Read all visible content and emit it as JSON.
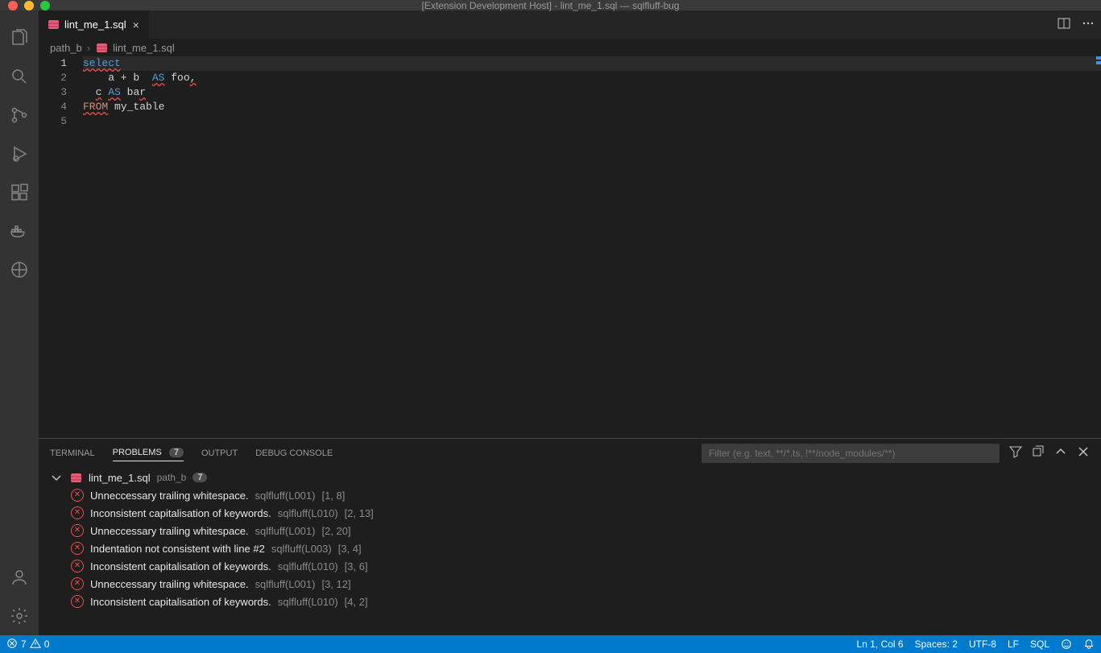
{
  "window": {
    "title": "[Extension Development Host] - lint_me_1.sql — sqlfluff-bug"
  },
  "tab": {
    "filename": "lint_me_1.sql"
  },
  "breadcrumb": {
    "folder": "path_b",
    "file": "lint_me_1.sql"
  },
  "editor": {
    "lines": [
      {
        "num": "1",
        "tokens": [
          {
            "t": "select",
            "cls": "kw-blue squiggle"
          }
        ]
      },
      {
        "num": "2",
        "tokens": [
          {
            "t": "    a + b  ",
            "cls": "plain"
          },
          {
            "t": "AS",
            "cls": "kw-blue squiggle"
          },
          {
            "t": " foo",
            "cls": "plain"
          },
          {
            "t": ",",
            "cls": "plain squiggle"
          }
        ]
      },
      {
        "num": "3",
        "tokens": [
          {
            "t": "  ",
            "cls": "plain"
          },
          {
            "t": "c",
            "cls": "plain squiggle"
          },
          {
            "t": " ",
            "cls": "plain"
          },
          {
            "t": "AS",
            "cls": "kw-blue squiggle"
          },
          {
            "t": " ba",
            "cls": "plain"
          },
          {
            "t": "r",
            "cls": "plain squiggle"
          }
        ]
      },
      {
        "num": "4",
        "tokens": [
          {
            "t": "FROM",
            "cls": "kw-orange squiggle"
          },
          {
            "t": " my_table",
            "cls": "plain"
          }
        ]
      },
      {
        "num": "5",
        "tokens": []
      }
    ]
  },
  "panel": {
    "tabs": {
      "terminal": "TERMINAL",
      "problems": "PROBLEMS",
      "problems_badge": "7",
      "output": "OUTPUT",
      "debug": "DEBUG CONSOLE"
    },
    "filter_placeholder": "Filter (e.g. text, **/*.ts, !**/node_modules/**)",
    "file": {
      "name": "lint_me_1.sql",
      "path": "path_b",
      "count": "7"
    },
    "problems": [
      {
        "msg": "Unneccessary trailing whitespace.",
        "source": "sqlfluff(L001)",
        "loc": "[1, 8]"
      },
      {
        "msg": "Inconsistent capitalisation of keywords.",
        "source": "sqlfluff(L010)",
        "loc": "[2, 13]"
      },
      {
        "msg": "Unneccessary trailing whitespace.",
        "source": "sqlfluff(L001)",
        "loc": "[2, 20]"
      },
      {
        "msg": "Indentation not consistent with line #2",
        "source": "sqlfluff(L003)",
        "loc": "[3, 4]"
      },
      {
        "msg": "Inconsistent capitalisation of keywords.",
        "source": "sqlfluff(L010)",
        "loc": "[3, 6]"
      },
      {
        "msg": "Unneccessary trailing whitespace.",
        "source": "sqlfluff(L001)",
        "loc": "[3, 12]"
      },
      {
        "msg": "Inconsistent capitalisation of keywords.",
        "source": "sqlfluff(L010)",
        "loc": "[4, 2]"
      }
    ]
  },
  "statusbar": {
    "errors": "7",
    "warnings": "0",
    "position": "Ln 1, Col 6",
    "spaces": "Spaces: 2",
    "encoding": "UTF-8",
    "eol": "LF",
    "lang": "SQL"
  }
}
